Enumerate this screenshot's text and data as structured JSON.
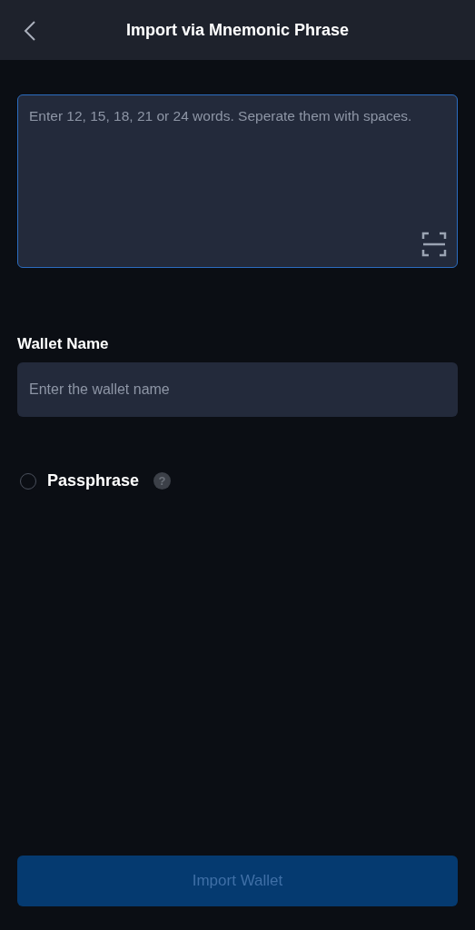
{
  "header": {
    "title": "Import via Mnemonic Phrase"
  },
  "mnemonic_field": {
    "placeholder": "Enter 12, 15, 18, 21 or 24 words. Seperate them with spaces."
  },
  "wallet_name": {
    "label": "Wallet Name",
    "placeholder": "Enter the wallet name"
  },
  "passphrase": {
    "label": "Passphrase",
    "checked": false,
    "help": "?"
  },
  "import_button": {
    "label": "Import Wallet",
    "disabled": true
  }
}
